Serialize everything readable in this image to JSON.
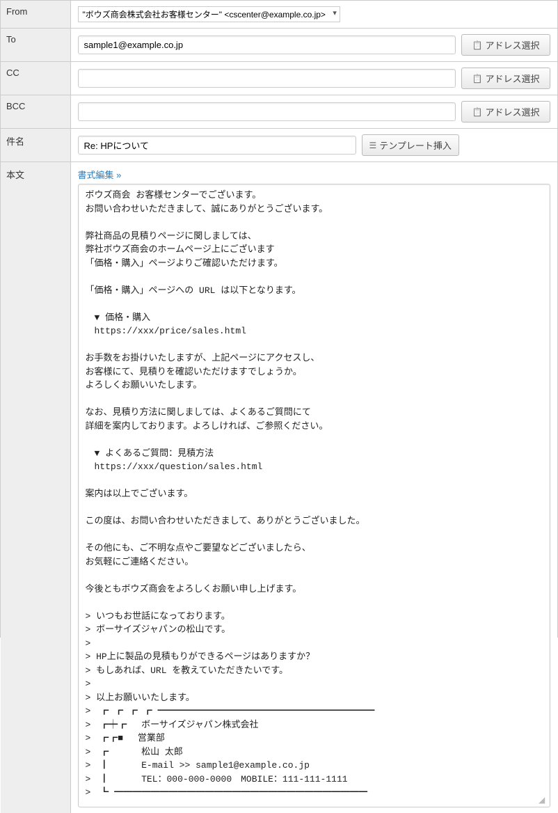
{
  "labels": {
    "from": "From",
    "to": "To",
    "cc": "CC",
    "bcc": "BCC",
    "subject": "件名",
    "body": "本文"
  },
  "from": {
    "value": "\"ボウズ商会株式会社お客様センター\" <cscenter@example.co.jp>"
  },
  "to": {
    "value": "sample1@example.co.jp"
  },
  "cc": {
    "value": ""
  },
  "bcc": {
    "value": ""
  },
  "subject": {
    "value": "Re: HPについて"
  },
  "buttons": {
    "addressSelect": "アドレス選択",
    "templateInsert": "テンプレート挿入"
  },
  "formatLink": {
    "label": "書式編集",
    "chev": "»"
  },
  "body": {
    "text": "ボウズ商会 お客様センターでございます。\nお問い合わせいただきまして、誠にありがとうございます。\n\n弊社商品の見積りページに関しましては、\n弊社ボウズ商会のホームページ上にございます\n「価格・購入」ページよりご確認いただけます。\n\n「価格・購入」ページへの URL は以下となります。\n\n　▼ 価格・購入\n　https://xxx/price/sales.html\n\nお手数をお掛けいたしますが、上記ページにアクセスし、\nお客様にて、見積りを確認いただけますでしょうか。\nよろしくお願いいたします。\n\nなお、見積り方法に関しましては、よくあるご質問にて\n詳細を案内しております。よろしければ、ご参照ください。\n\n　▼ よくあるご質問：見積方法\n　https://xxx/question/sales.html\n\n案内は以上でございます。\n\nこの度は、お問い合わせいただきまして、ありがとうございました。\n\nその他にも、ご不明な点やご要望などございましたら、\nお気軽にご連絡ください。\n\n今後ともボウズ商会をよろしくお願い申し上げます。\n\n> いつもお世話になっております。\n> ボーサイズジャパンの松山です。\n>\n> HP上に製品の見積もりができるページはありますか？\n> もしあれば、URL を教えていただきたいです。\n>\n> 以上お願いいたします。\n>　┏ ┏ ┏ ┏ ━━━━━━━━━━━━━━━━━━━━━━━━\n>　┏┿┏ 　ボーサイズジャパン株式会社\n>　┏┏■ 　営業部\n>　┏ 　　　松山 太郎\n>　┃ 　　　E-mail >> sample1@example.co.jp\n>　┃ 　　　TEL：000-000-0000　MOBILE：111-111-1111\n>　┗ ━━━━━━━━━━━━━━━━━━━━━━━━━━━━"
  }
}
